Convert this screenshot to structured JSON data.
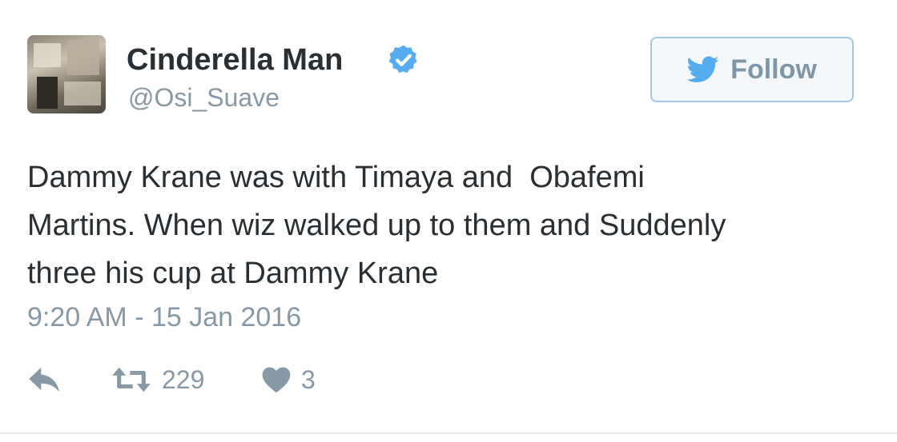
{
  "user": {
    "display_name": "Cinderella Man",
    "handle": "@Osi_Suave",
    "verified": true,
    "avatar_icon": "profile-photo"
  },
  "follow_button": {
    "label": "Follow",
    "icon": "twitter-bird-icon"
  },
  "tweet": {
    "text_lines": [
      "Dammy Krane was with Timaya and  Obafemi",
      "Martins. When wiz walked up to them and Suddenly",
      "three his cup at Dammy Krane"
    ],
    "timestamp": "9:20 AM - 15 Jan 2016"
  },
  "actions": {
    "reply_icon": "reply-icon",
    "retweet_icon": "retweet-icon",
    "retweet_count": "229",
    "like_icon": "heart-icon",
    "like_count": "3"
  },
  "colors": {
    "text": "#292f33",
    "muted": "#8899a6",
    "verified_blue": "#55acee",
    "follow_border": "#a3c8e0",
    "icon_gray": "#8899a6"
  }
}
